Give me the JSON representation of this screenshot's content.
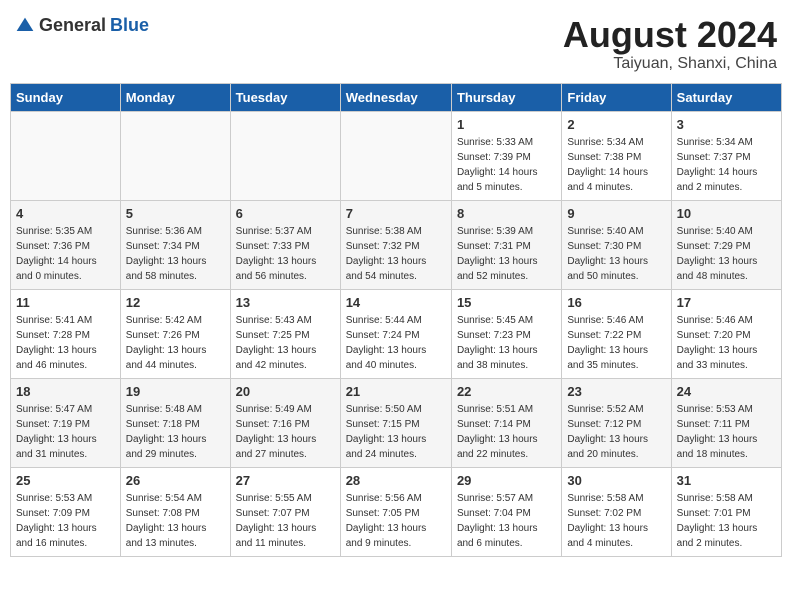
{
  "header": {
    "logo_general": "General",
    "logo_blue": "Blue",
    "month_title": "August 2024",
    "location": "Taiyuan, Shanxi, China"
  },
  "calendar": {
    "days_of_week": [
      "Sunday",
      "Monday",
      "Tuesday",
      "Wednesday",
      "Thursday",
      "Friday",
      "Saturday"
    ],
    "weeks": [
      [
        {
          "day": "",
          "info": ""
        },
        {
          "day": "",
          "info": ""
        },
        {
          "day": "",
          "info": ""
        },
        {
          "day": "",
          "info": ""
        },
        {
          "day": "1",
          "info": "Sunrise: 5:33 AM\nSunset: 7:39 PM\nDaylight: 14 hours\nand 5 minutes."
        },
        {
          "day": "2",
          "info": "Sunrise: 5:34 AM\nSunset: 7:38 PM\nDaylight: 14 hours\nand 4 minutes."
        },
        {
          "day": "3",
          "info": "Sunrise: 5:34 AM\nSunset: 7:37 PM\nDaylight: 14 hours\nand 2 minutes."
        }
      ],
      [
        {
          "day": "4",
          "info": "Sunrise: 5:35 AM\nSunset: 7:36 PM\nDaylight: 14 hours\nand 0 minutes."
        },
        {
          "day": "5",
          "info": "Sunrise: 5:36 AM\nSunset: 7:34 PM\nDaylight: 13 hours\nand 58 minutes."
        },
        {
          "day": "6",
          "info": "Sunrise: 5:37 AM\nSunset: 7:33 PM\nDaylight: 13 hours\nand 56 minutes."
        },
        {
          "day": "7",
          "info": "Sunrise: 5:38 AM\nSunset: 7:32 PM\nDaylight: 13 hours\nand 54 minutes."
        },
        {
          "day": "8",
          "info": "Sunrise: 5:39 AM\nSunset: 7:31 PM\nDaylight: 13 hours\nand 52 minutes."
        },
        {
          "day": "9",
          "info": "Sunrise: 5:40 AM\nSunset: 7:30 PM\nDaylight: 13 hours\nand 50 minutes."
        },
        {
          "day": "10",
          "info": "Sunrise: 5:40 AM\nSunset: 7:29 PM\nDaylight: 13 hours\nand 48 minutes."
        }
      ],
      [
        {
          "day": "11",
          "info": "Sunrise: 5:41 AM\nSunset: 7:28 PM\nDaylight: 13 hours\nand 46 minutes."
        },
        {
          "day": "12",
          "info": "Sunrise: 5:42 AM\nSunset: 7:26 PM\nDaylight: 13 hours\nand 44 minutes."
        },
        {
          "day": "13",
          "info": "Sunrise: 5:43 AM\nSunset: 7:25 PM\nDaylight: 13 hours\nand 42 minutes."
        },
        {
          "day": "14",
          "info": "Sunrise: 5:44 AM\nSunset: 7:24 PM\nDaylight: 13 hours\nand 40 minutes."
        },
        {
          "day": "15",
          "info": "Sunrise: 5:45 AM\nSunset: 7:23 PM\nDaylight: 13 hours\nand 38 minutes."
        },
        {
          "day": "16",
          "info": "Sunrise: 5:46 AM\nSunset: 7:22 PM\nDaylight: 13 hours\nand 35 minutes."
        },
        {
          "day": "17",
          "info": "Sunrise: 5:46 AM\nSunset: 7:20 PM\nDaylight: 13 hours\nand 33 minutes."
        }
      ],
      [
        {
          "day": "18",
          "info": "Sunrise: 5:47 AM\nSunset: 7:19 PM\nDaylight: 13 hours\nand 31 minutes."
        },
        {
          "day": "19",
          "info": "Sunrise: 5:48 AM\nSunset: 7:18 PM\nDaylight: 13 hours\nand 29 minutes."
        },
        {
          "day": "20",
          "info": "Sunrise: 5:49 AM\nSunset: 7:16 PM\nDaylight: 13 hours\nand 27 minutes."
        },
        {
          "day": "21",
          "info": "Sunrise: 5:50 AM\nSunset: 7:15 PM\nDaylight: 13 hours\nand 24 minutes."
        },
        {
          "day": "22",
          "info": "Sunrise: 5:51 AM\nSunset: 7:14 PM\nDaylight: 13 hours\nand 22 minutes."
        },
        {
          "day": "23",
          "info": "Sunrise: 5:52 AM\nSunset: 7:12 PM\nDaylight: 13 hours\nand 20 minutes."
        },
        {
          "day": "24",
          "info": "Sunrise: 5:53 AM\nSunset: 7:11 PM\nDaylight: 13 hours\nand 18 minutes."
        }
      ],
      [
        {
          "day": "25",
          "info": "Sunrise: 5:53 AM\nSunset: 7:09 PM\nDaylight: 13 hours\nand 16 minutes."
        },
        {
          "day": "26",
          "info": "Sunrise: 5:54 AM\nSunset: 7:08 PM\nDaylight: 13 hours\nand 13 minutes."
        },
        {
          "day": "27",
          "info": "Sunrise: 5:55 AM\nSunset: 7:07 PM\nDaylight: 13 hours\nand 11 minutes."
        },
        {
          "day": "28",
          "info": "Sunrise: 5:56 AM\nSunset: 7:05 PM\nDaylight: 13 hours\nand 9 minutes."
        },
        {
          "day": "29",
          "info": "Sunrise: 5:57 AM\nSunset: 7:04 PM\nDaylight: 13 hours\nand 6 minutes."
        },
        {
          "day": "30",
          "info": "Sunrise: 5:58 AM\nSunset: 7:02 PM\nDaylight: 13 hours\nand 4 minutes."
        },
        {
          "day": "31",
          "info": "Sunrise: 5:58 AM\nSunset: 7:01 PM\nDaylight: 13 hours\nand 2 minutes."
        }
      ]
    ]
  }
}
